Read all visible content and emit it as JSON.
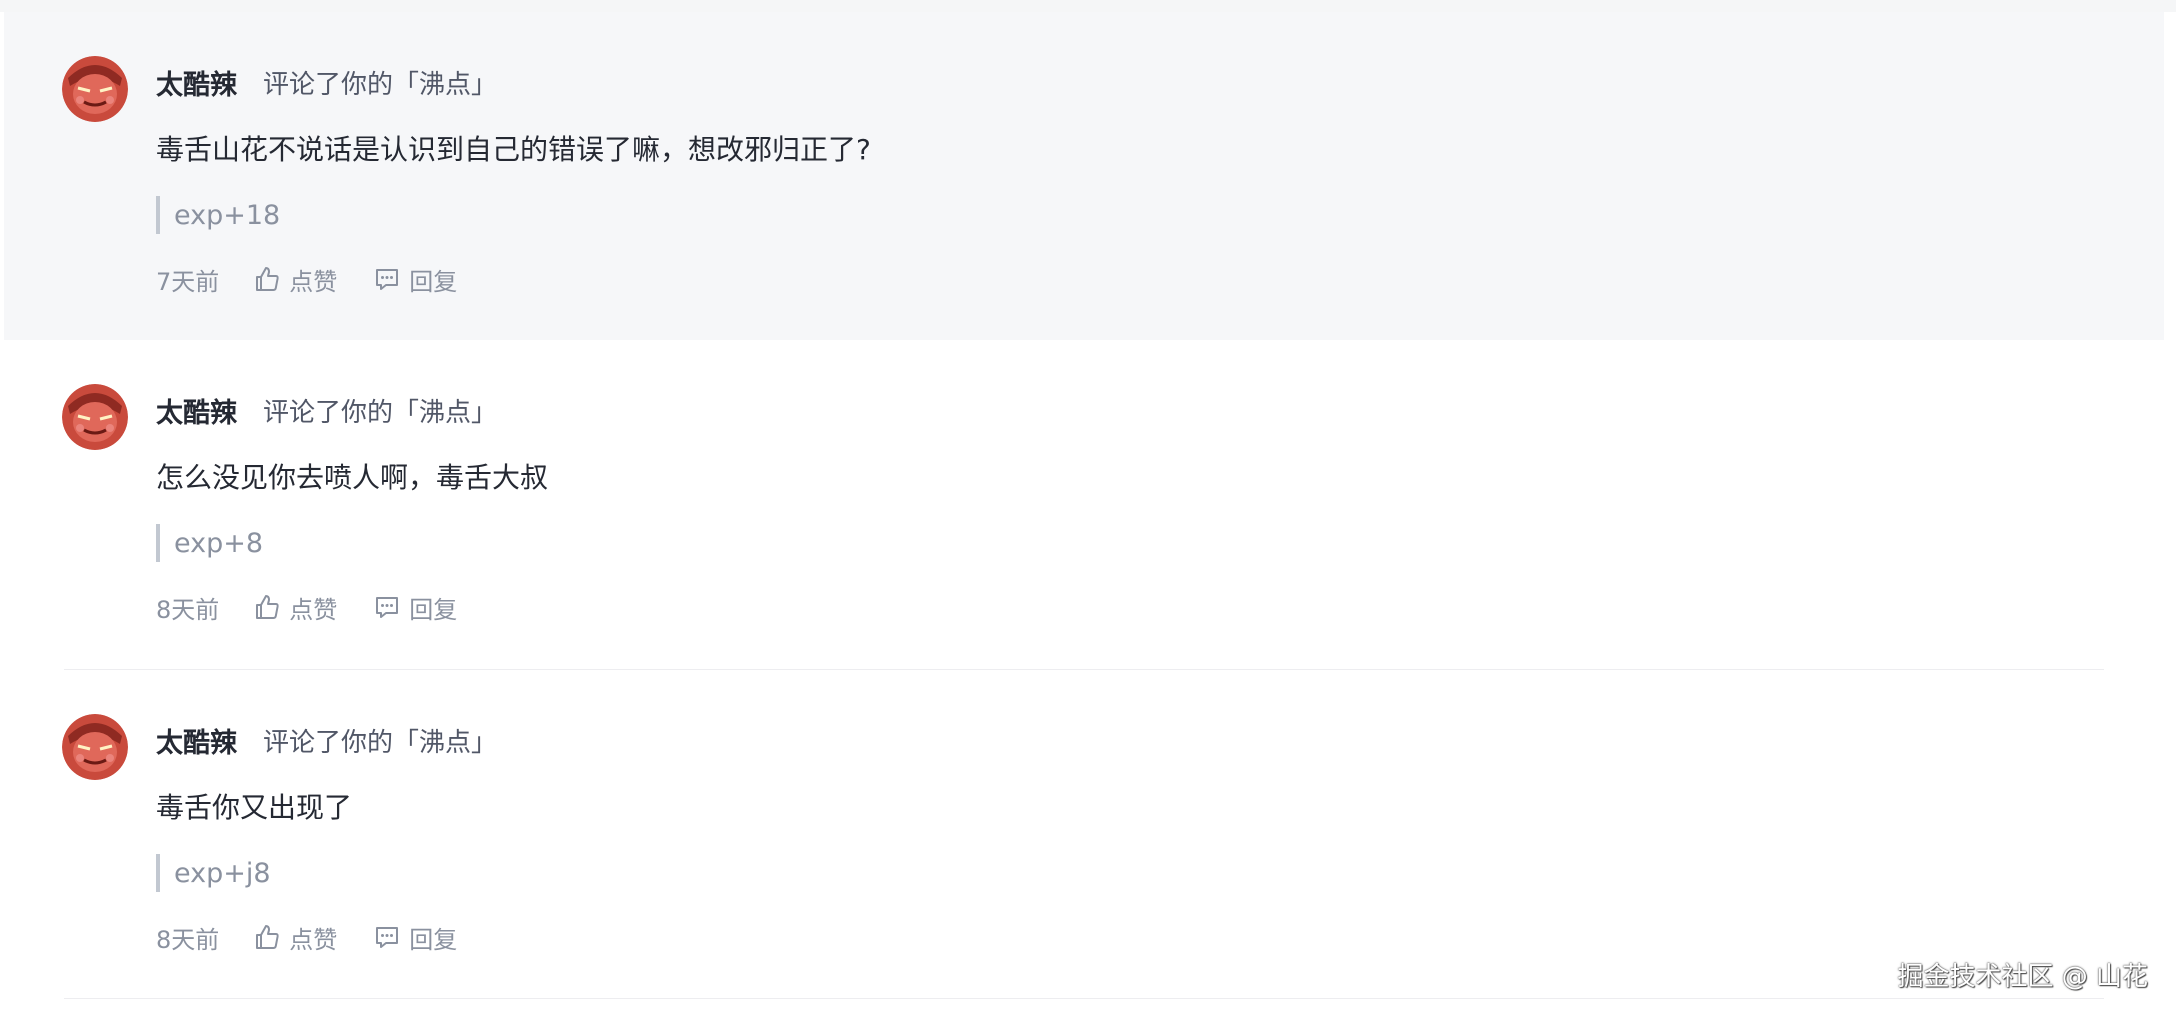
{
  "notifications": [
    {
      "username": "太酷辣",
      "action": "评论了你的「沸点」",
      "content": "毒舌山花不说话是认识到自己的错误了嘛，想改邪归正了?",
      "exp": "exp+18",
      "time": "7天前",
      "like_label": "点赞",
      "reply_label": "回复",
      "highlighted": true
    },
    {
      "username": "太酷辣",
      "action": "评论了你的「沸点」",
      "content": "怎么没见你去喷人啊，毒舌大叔",
      "exp": "exp+8",
      "time": "8天前",
      "like_label": "点赞",
      "reply_label": "回复",
      "highlighted": false
    },
    {
      "username": "太酷辣",
      "action": "评论了你的「沸点」",
      "content": "毒舌你又出现了",
      "exp": "exp+j8",
      "time": "8天前",
      "like_label": "点赞",
      "reply_label": "回复",
      "highlighted": false
    }
  ],
  "watermark": "掘金技术社区 @ 山花",
  "icons": {
    "like": "thumbs-up-icon",
    "reply": "comment-icon"
  },
  "colors": {
    "highlight_bg": "#f6f7f9",
    "text_primary": "#252933",
    "text_secondary": "#8a919f"
  }
}
